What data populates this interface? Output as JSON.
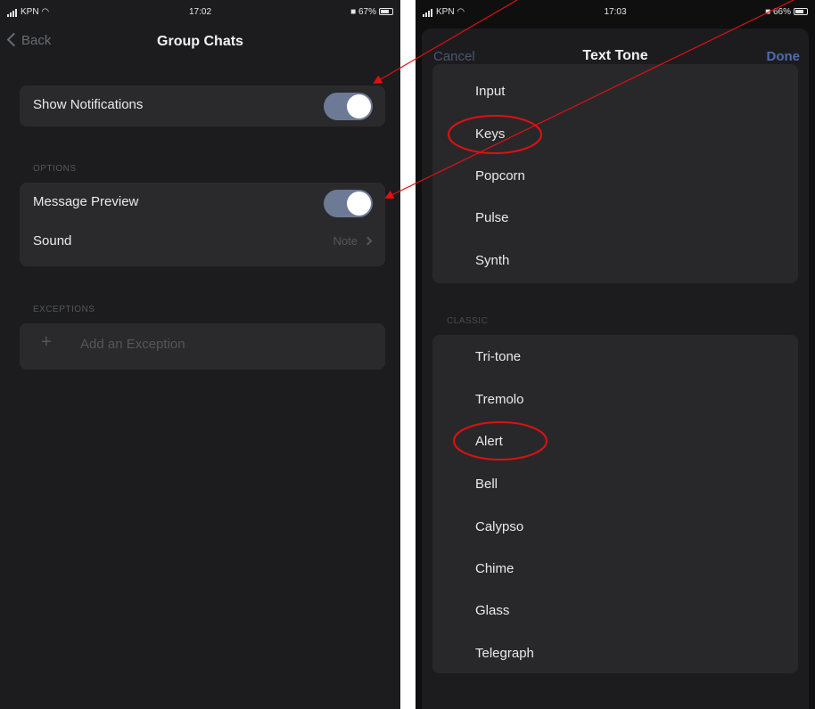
{
  "left_screen": {
    "status": {
      "carrier": "KPN",
      "time": "17:02",
      "battery": "67%"
    },
    "nav": {
      "back_label": "Back",
      "title": "Group Chats"
    },
    "show_notifications": {
      "label": "Show Notifications",
      "on": true
    },
    "options_header": "OPTIONS",
    "message_preview": {
      "label": "Message Preview",
      "on": true
    },
    "sound": {
      "label": "Sound",
      "value": "Note"
    },
    "exceptions_header": "EXCEPTIONS",
    "add_exception": {
      "icon": "+",
      "label": "Add an Exception"
    }
  },
  "right_screen": {
    "status": {
      "carrier": "KPN",
      "time": "17:03",
      "battery": "66%"
    },
    "nav": {
      "cancel_label": "Cancel",
      "title": "Text Tone",
      "done_label": "Done"
    },
    "tones_top": [
      "Input",
      "Keys",
      "Popcorn",
      "Pulse",
      "Synth"
    ],
    "classic_header": "CLASSIC",
    "tones_classic": [
      "Tri-tone",
      "Tremolo",
      "Alert",
      "Bell",
      "Calypso",
      "Chime",
      "Glass",
      "Telegraph"
    ]
  },
  "annotations": {
    "color": "#e01010",
    "circled_tones": [
      "Keys",
      "Alert"
    ],
    "arrow_targets": [
      "Show Notifications",
      "Message Preview"
    ]
  }
}
